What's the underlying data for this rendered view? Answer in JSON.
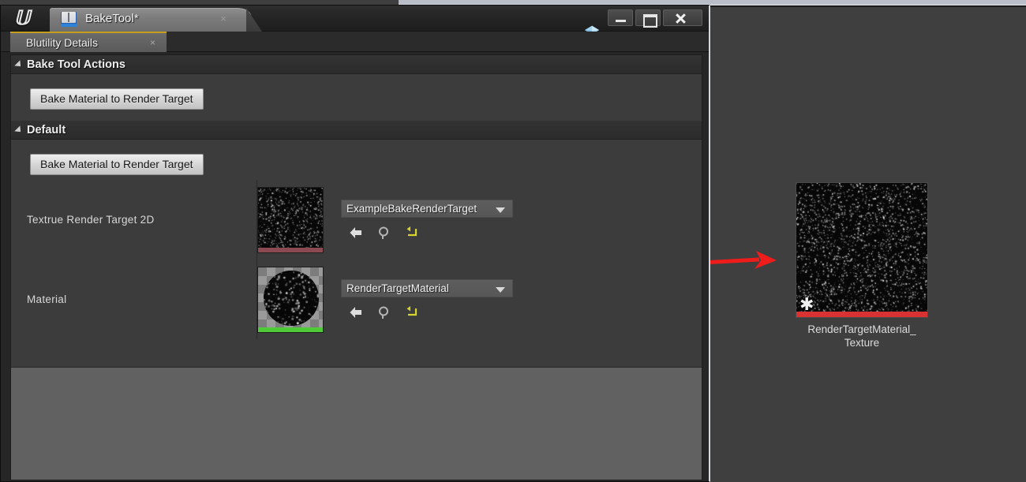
{
  "window": {
    "app_icon": "unreal-engine-logo",
    "document_tab": {
      "title": "BakeTool*",
      "icon": "blueprint-book-icon",
      "close": "×"
    },
    "gem_icon": "blue-gem-icon",
    "controls": {
      "minimize": "minimize-icon",
      "maximize": "maximize-icon",
      "close": "close-icon"
    }
  },
  "panel": {
    "tab": {
      "label": "Blutility Details",
      "close": "×"
    }
  },
  "details": {
    "categories": [
      {
        "title": "Bake Tool Actions",
        "expanded": true,
        "arrow": "collapse-arrow-icon",
        "button_label": "Bake Material to Render Target"
      },
      {
        "title": "Default",
        "expanded": true,
        "arrow": "collapse-arrow-icon",
        "button_label": "Bake Material to Render Target"
      }
    ],
    "properties": [
      {
        "label": "Textrue Render Target 2D",
        "asset_name": "ExampleBakeRenderTarget",
        "thumbnail": "render-target-noise-thumbnail",
        "type_bar_color": "#8b4a52",
        "actions": [
          "use-selected-asset-icon",
          "browse-to-asset-icon",
          "reset-to-default-icon"
        ]
      },
      {
        "label": "Material",
        "asset_name": "RenderTargetMaterial",
        "thumbnail": "material-sphere-thumbnail",
        "type_bar_color": "#4ecb36",
        "actions": [
          "use-selected-asset-icon",
          "browse-to-asset-icon",
          "reset-to-default-icon"
        ]
      }
    ]
  },
  "content_browser": {
    "asset": {
      "name_line1": "RenderTargetMaterial_",
      "name_line2": "Texture",
      "thumbnail": "noise-texture-thumbnail",
      "type_bar_color": "#d93232",
      "dirty_badge": "✱"
    }
  },
  "annotation": {
    "arrow_color": "#ef1c1c",
    "direction": "points-right"
  },
  "colors": {
    "window_bg": "#262626",
    "details_bg": "#3c3c3c",
    "category_bg": "#2f2f2f",
    "desktop_bg": "#3f3f3f",
    "tab_accent": "#c8a020"
  }
}
